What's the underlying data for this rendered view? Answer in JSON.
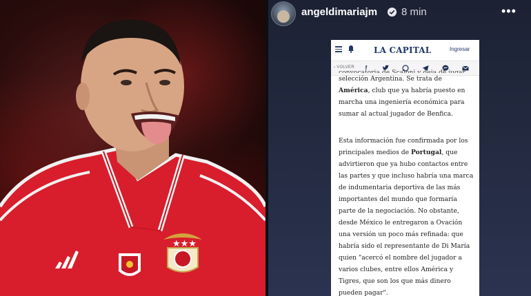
{
  "story": {
    "username": "angeldimariajm",
    "time": "8 min",
    "more": "•••"
  },
  "article": {
    "brand": "LA CAPITAL",
    "login": "Ingresar",
    "back": "‹ VOLVER",
    "cut_line": "convocatoria de Scaloni y deja de jugar en la",
    "p1": {
      "t1": "selección Argentina. Se trata de ",
      "b1": "América",
      "t2": ", club que ya habría puesto en marcha una ingeniería económica para sumar al actual jugador de Benfica."
    },
    "p2": {
      "t1": "Esta información fue confirmada por los principales medios de ",
      "b1": "Portugal",
      "t2": ", que advirtieron que ya hubo contactos entre las partes y que incluso habría una marca de indumentaria deportiva de las más importantes del mundo que formaría parte de la negociación. No obstante, desde México le entregaron a Ovación una versión un poco más refinada: que habría sido el representante de Di María quien \"acercó el nombre del jugador a varios clubes, entre ellos América y Tigres, que son los que más dinero pueden pagar\"."
    },
    "share_icons": [
      "facebook-icon",
      "twitter-icon",
      "whatsapp-icon",
      "telegram-icon",
      "messenger-icon",
      "email-icon"
    ]
  },
  "colors": {
    "benfica_red": "#d81e2c",
    "article_navy": "#1f3766",
    "story_bg": "#1c2233"
  }
}
